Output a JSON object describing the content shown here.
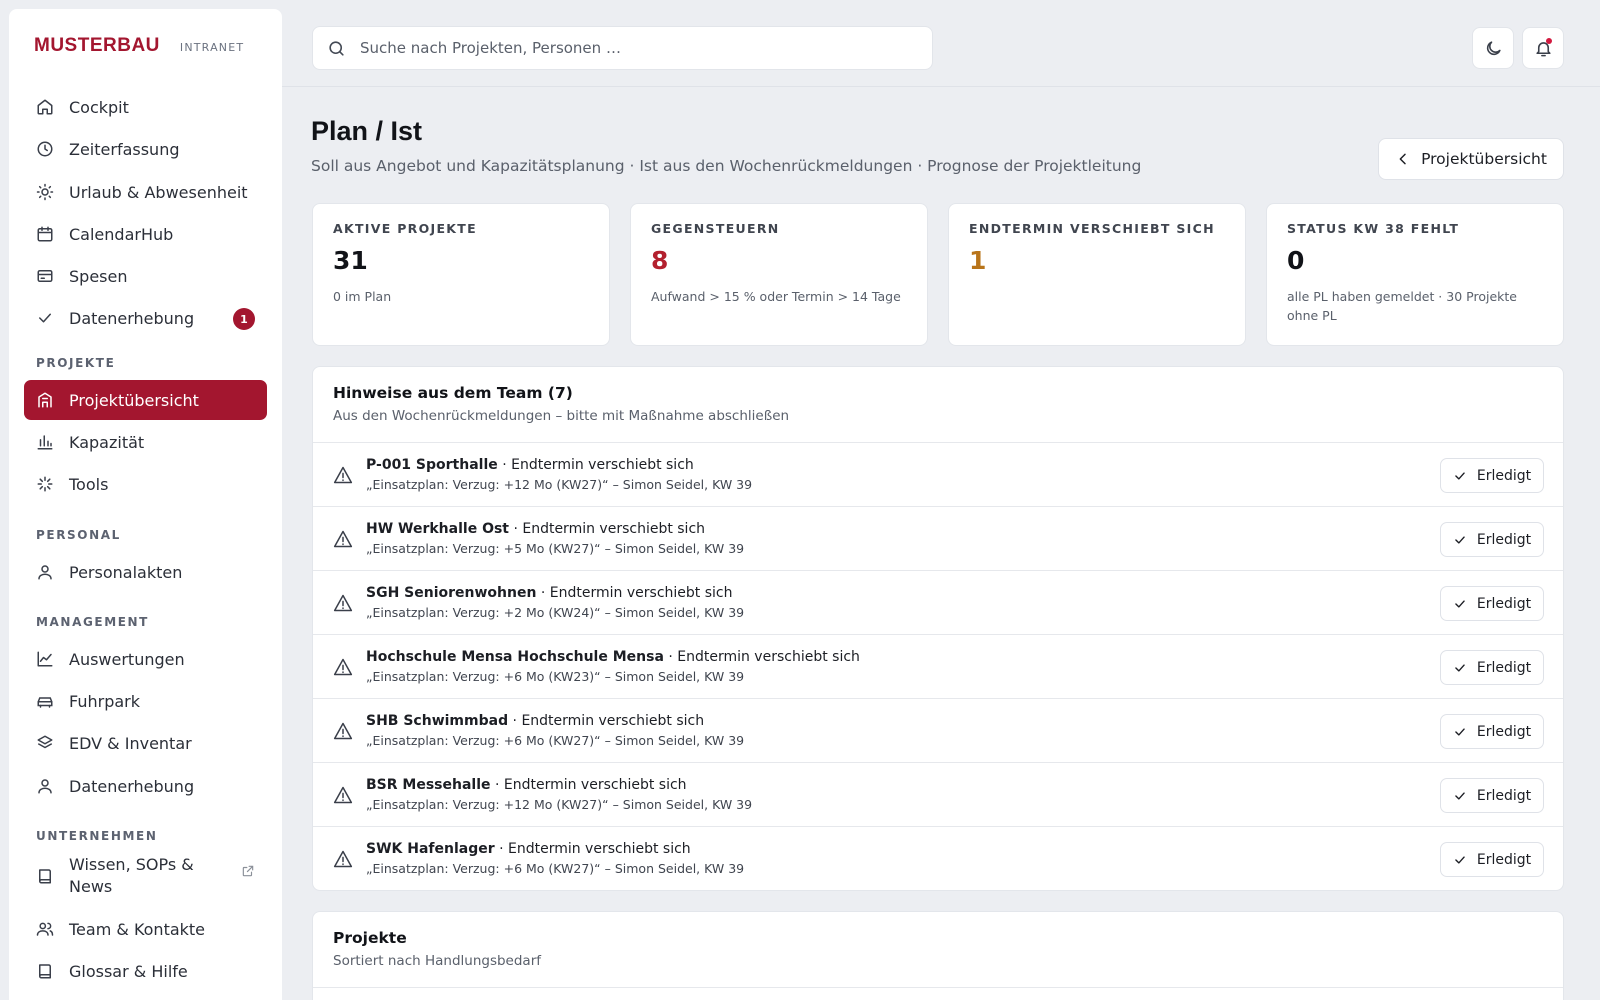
{
  "brand": {
    "name": "MUSTERBAU",
    "tag": "INTRANET"
  },
  "sidebar": {
    "items": [
      {
        "label": "Cockpit",
        "icon": "home-icon"
      },
      {
        "label": "Zeiterfassung",
        "icon": "clock-icon"
      },
      {
        "label": "Urlaub & Abwesenheit",
        "icon": "sun-icon"
      },
      {
        "label": "CalendarHub",
        "icon": "calendar-icon"
      },
      {
        "label": "Spesen",
        "icon": "credit-card-icon"
      },
      {
        "label": "Datenerhebung",
        "icon": "check-icon",
        "badge": "1"
      }
    ],
    "sections": [
      {
        "label": "PROJEKTE",
        "items": [
          {
            "label": "Projektübersicht",
            "icon": "building-icon",
            "active": true
          },
          {
            "label": "Kapazität",
            "icon": "bar-chart-icon"
          },
          {
            "label": "Tools",
            "icon": "loader-icon"
          }
        ]
      },
      {
        "label": "PERSONAL",
        "items": [
          {
            "label": "Personalakten",
            "icon": "user-icon"
          }
        ]
      },
      {
        "label": "MANAGEMENT",
        "items": [
          {
            "label": "Auswertungen",
            "icon": "line-chart-icon"
          },
          {
            "label": "Fuhrpark",
            "icon": "car-icon"
          },
          {
            "label": "EDV & Inventar",
            "icon": "layers-icon"
          },
          {
            "label": "Datenerhebung",
            "icon": "user-icon"
          }
        ]
      },
      {
        "label": "UNTERNEHMEN",
        "items": [
          {
            "label": "Wissen, SOPs & News",
            "label_line1": "Wissen, SOPs &",
            "label_line2": "News",
            "icon": "book-icon",
            "external": true
          },
          {
            "label": "Team & Kontakte",
            "icon": "users-icon"
          },
          {
            "label": "Glossar & Hilfe",
            "icon": "book-icon"
          }
        ]
      }
    ]
  },
  "search": {
    "placeholder": "Suche nach Projekten, Personen …",
    "value": ""
  },
  "header": {
    "title": "Plan / Ist",
    "subtitle": "Soll aus Angebot und Kapazitätsplanung · Ist aus den Wochenrückmeldungen · Prognose der Projektleitung",
    "back_button": "Projektübersicht"
  },
  "kpis": [
    {
      "label": "AKTIVE PROJEKTE",
      "value": "31",
      "note": "0 im Plan",
      "color": "#111318"
    },
    {
      "label": "GEGENSTEUERN",
      "value": "8",
      "note": "Aufwand > 15 % oder Termin > 14 Tage",
      "color": "#b3202e"
    },
    {
      "label": "ENDTERMIN VERSCHIEBT SICH",
      "value": "1",
      "note": "",
      "color": "#b8741a"
    },
    {
      "label": "STATUS KW 38 FEHLT",
      "value": "0",
      "note": "alle PL haben gemeldet · 30 Projekte ohne PL",
      "color": "#111318"
    }
  ],
  "hints": {
    "title": "Hinweise aus dem Team (7)",
    "subtitle": "Aus den Wochenrückmeldungen – bitte mit Maßnahme abschließen",
    "done_label": "Erledigt",
    "rows": [
      {
        "project": "P-001 Sporthalle",
        "status": " · Endtermin verschiebt sich",
        "note": "„Einsatzplan: Verzug: +12 Mo (KW27)“ – Simon Seidel, KW 39"
      },
      {
        "project": "HW Werkhalle Ost",
        "status": " · Endtermin verschiebt sich",
        "note": "„Einsatzplan: Verzug: +5 Mo (KW27)“ – Simon Seidel, KW 39"
      },
      {
        "project": "SGH Seniorenwohnen",
        "status": " · Endtermin verschiebt sich",
        "note": "„Einsatzplan: Verzug: +2 Mo (KW24)“ – Simon Seidel, KW 39"
      },
      {
        "project": "Hochschule Mensa Hochschule Mensa",
        "status": " · Endtermin verschiebt sich",
        "note": "„Einsatzplan: Verzug: +6 Mo (KW23)“ – Simon Seidel, KW 39"
      },
      {
        "project": "SHB Schwimmbad",
        "status": " · Endtermin verschiebt sich",
        "note": "„Einsatzplan: Verzug: +6 Mo (KW27)“ – Simon Seidel, KW 39"
      },
      {
        "project": "BSR Messehalle",
        "status": " · Endtermin verschiebt sich",
        "note": "„Einsatzplan: Verzug: +12 Mo (KW27)“ – Simon Seidel, KW 39"
      },
      {
        "project": "SWK Hafenlager",
        "status": " · Endtermin verschiebt sich",
        "note": "„Einsatzplan: Verzug: +6 Mo (KW27)“ – Simon Seidel, KW 39"
      }
    ]
  },
  "projects_panel": {
    "title": "Projekte",
    "subtitle": "Sortiert nach Handlungsbedarf"
  },
  "colors": {
    "accent": "#a3162f",
    "warning": "#b8741a",
    "danger": "#b3202e"
  }
}
